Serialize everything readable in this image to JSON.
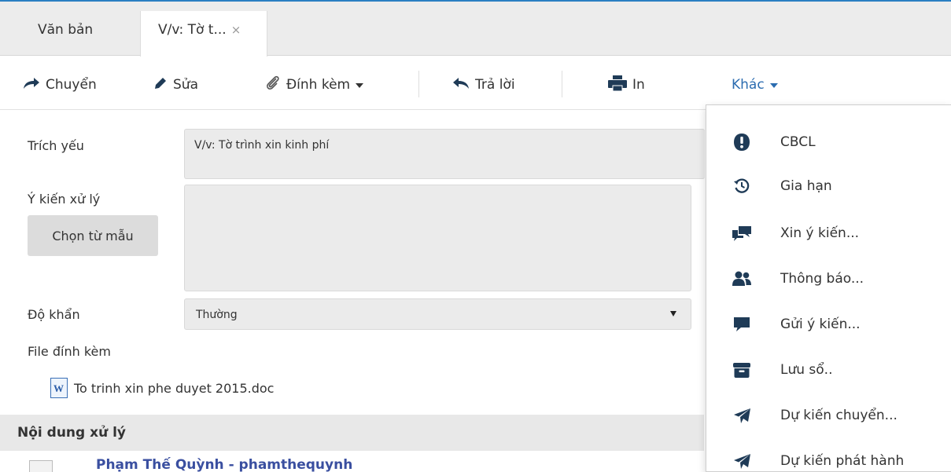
{
  "tabs": [
    {
      "label": "Văn bản"
    },
    {
      "label": "V/v: Tờ t...",
      "close": "×"
    }
  ],
  "toolbar": {
    "chuyen": "Chuyển",
    "sua": "Sửa",
    "dinh_kem": "Đính kèm",
    "tra_loi": "Trả lời",
    "in": "In",
    "khac": "Khác"
  },
  "form": {
    "trich_yeu_label": "Trích yếu",
    "trich_yeu_value": "V/v: Tờ trình xin kinh phí",
    "y_kien_label": "Ý kiến xử lý",
    "chon_mau": "Chọn từ mẫu",
    "do_khan_label": "Độ khẩn",
    "do_khan_value": "Thường",
    "file_label": "File đính kèm",
    "file_name": "To trinh xin phe duyet 2015.doc",
    "file_icon_letter": "W"
  },
  "section": {
    "title": "Nội dung xử lý",
    "person": "Phạm Thế Quỳnh - phamthequynh"
  },
  "menu": {
    "items": [
      {
        "label": "CBCL",
        "icon": "exclamation-icon"
      },
      {
        "label": "Gia hạn",
        "icon": "history-icon"
      },
      {
        "label": "Xin ý kiến...",
        "icon": "comments-icon"
      },
      {
        "label": "Thông báo...",
        "icon": "users-icon"
      },
      {
        "label": "Gửi ý kiến...",
        "icon": "comment-icon"
      },
      {
        "label": "Lưu sổ..",
        "icon": "archive-icon"
      },
      {
        "label": "Dự kiến chuyển...",
        "icon": "paper-plane-icon"
      },
      {
        "label": "Dự kiến phát hành",
        "icon": "paper-plane-icon"
      }
    ]
  },
  "colors": {
    "accent": "#2b6cb0",
    "icon_dark": "#1f3b57",
    "link": "#3a4fa0"
  }
}
